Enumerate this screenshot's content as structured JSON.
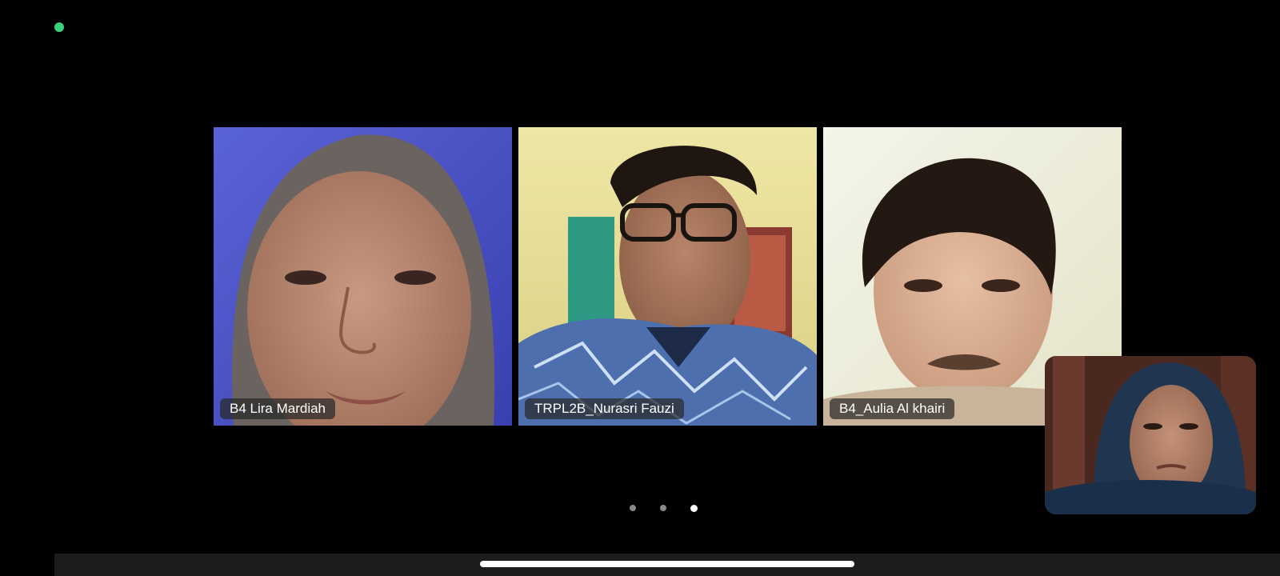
{
  "meeting": {
    "participants": [
      {
        "name": "B4 Lira Mardiah"
      },
      {
        "name": "TRPL2B_Nurasri Fauzi"
      },
      {
        "name": "B4_Aulia Al khairi"
      }
    ],
    "self_view": {
      "name": ""
    },
    "pagination": {
      "total_pages": 3,
      "current_page": 3
    }
  },
  "colors": {
    "background": "#000000",
    "status_dot": "#3ccf7a",
    "name_tag_bg": "#282828",
    "page_dot_inactive": "#8a8a8a",
    "page_dot_active": "#ffffff"
  }
}
